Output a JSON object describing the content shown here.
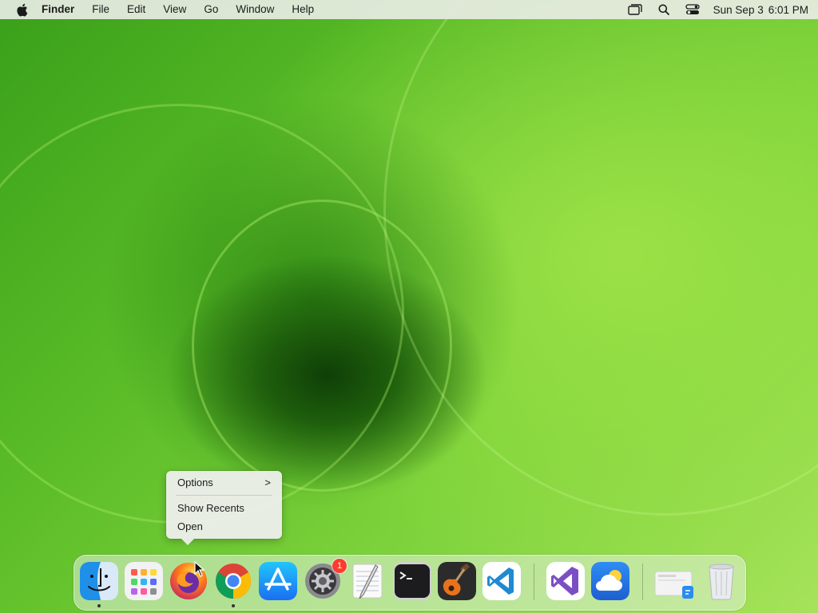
{
  "menubar": {
    "app_name": "Finder",
    "menus": [
      "File",
      "Edit",
      "View",
      "Go",
      "Window",
      "Help"
    ],
    "status_icons": [
      "window-switcher-icon",
      "search-icon",
      "control-center-icon"
    ],
    "date": "Sun Sep 3",
    "time": "6:01 PM"
  },
  "context_menu": {
    "items": [
      {
        "label": "Options",
        "submenu_glyph": ">"
      },
      {
        "label": "Show Recents"
      },
      {
        "label": "Open"
      }
    ]
  },
  "dock": {
    "apps": [
      {
        "name": "Finder",
        "icon": "finder-icon",
        "running": true
      },
      {
        "name": "Launchpad",
        "icon": "launchpad-icon",
        "running": false
      },
      {
        "name": "Firefox",
        "icon": "firefox-icon",
        "running": false
      },
      {
        "name": "Google Chrome",
        "icon": "chrome-icon",
        "running": true
      },
      {
        "name": "App Store",
        "icon": "app-store-icon",
        "running": false
      },
      {
        "name": "System Preferences",
        "icon": "system-preferences-icon",
        "running": false,
        "badge": "1"
      },
      {
        "name": "TextEdit",
        "icon": "textedit-icon",
        "running": false
      },
      {
        "name": "Terminal",
        "icon": "terminal-icon",
        "running": false
      },
      {
        "name": "GarageBand",
        "icon": "garageband-icon",
        "running": false
      },
      {
        "name": "Visual Studio Code",
        "icon": "vscode-icon",
        "running": false
      },
      {
        "name": "Visual Studio",
        "icon": "visual-studio-icon",
        "running": false
      },
      {
        "name": "Weather",
        "icon": "weather-icon",
        "running": false
      },
      {
        "name": "Downloads",
        "icon": "downloads-stack-icon",
        "running": false
      },
      {
        "name": "Trash",
        "icon": "trash-icon",
        "running": false
      }
    ]
  },
  "colors": {
    "badge": "#ff3b30",
    "vscode_blue": "#1f8ad2",
    "visual_studio_purple": "#7b4fc4"
  }
}
